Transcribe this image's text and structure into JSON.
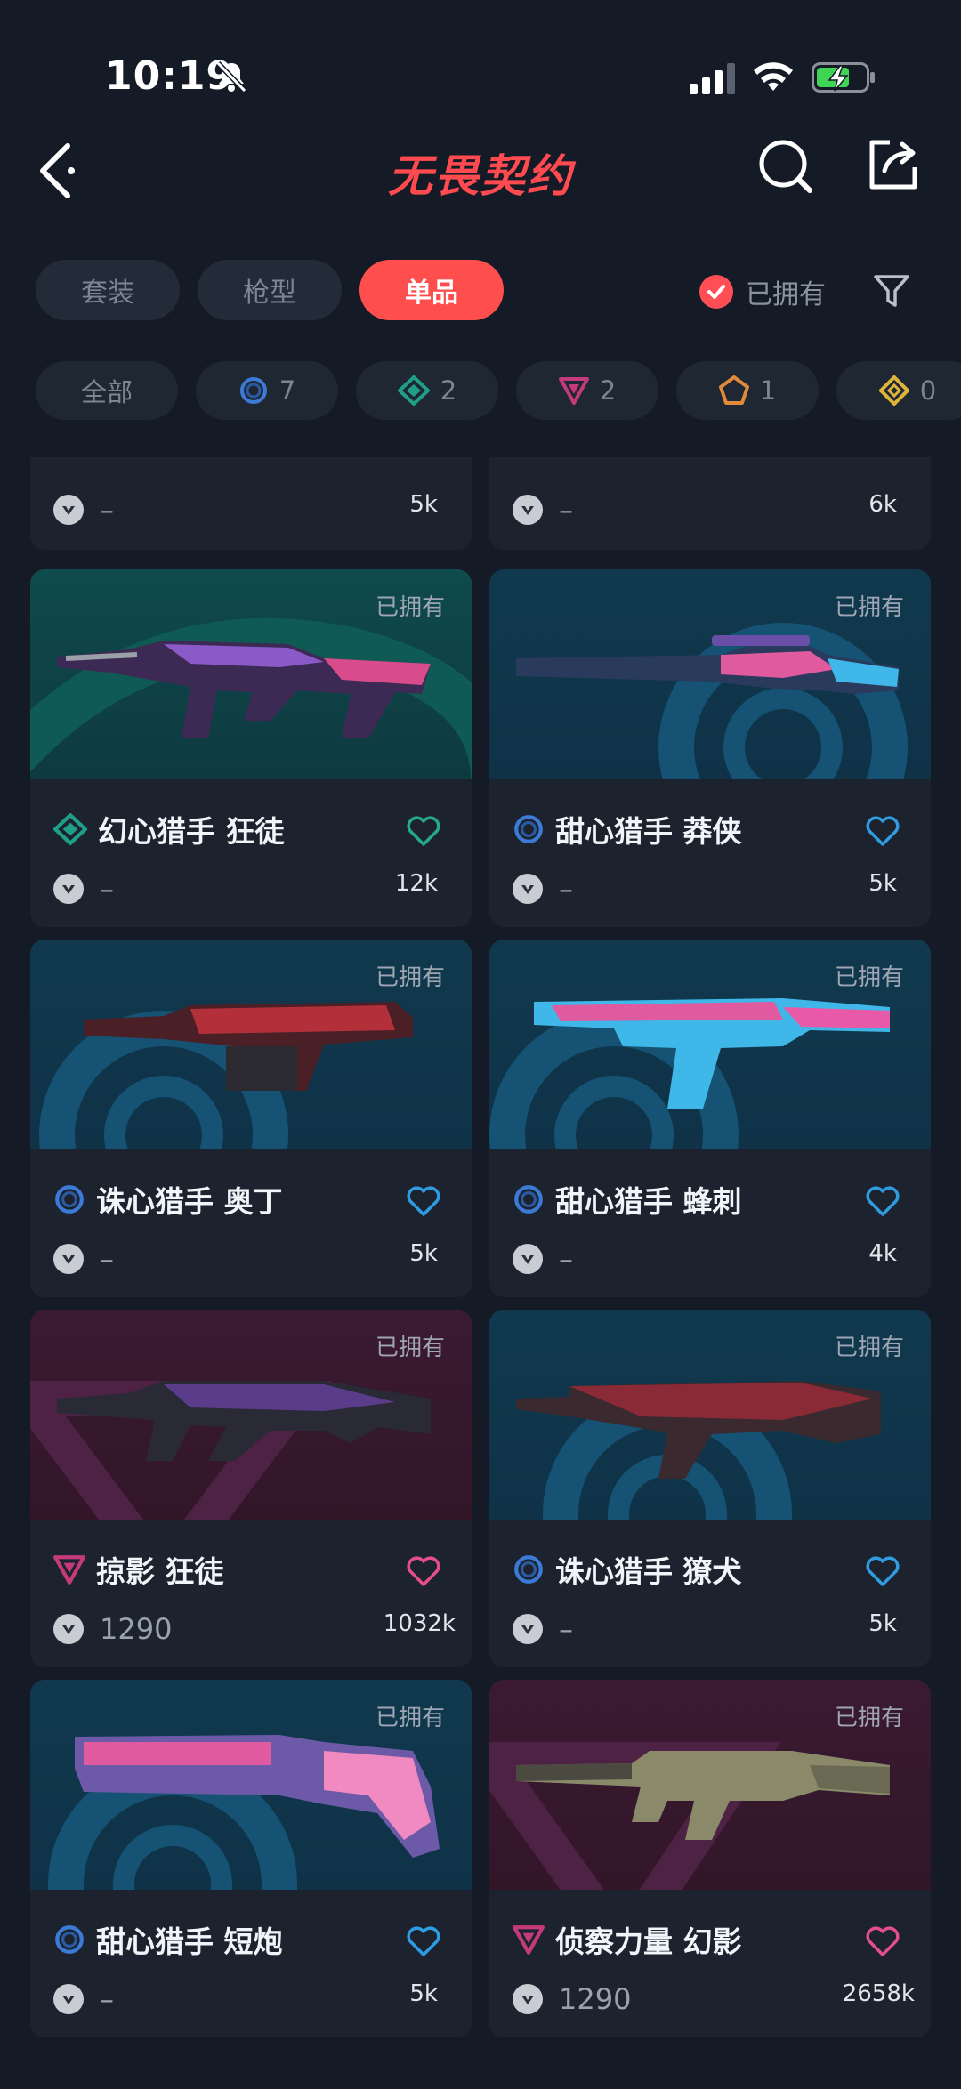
{
  "status": {
    "time": "10:19"
  },
  "nav": {
    "title": "无畏契约"
  },
  "tabs": [
    {
      "label": "套装",
      "active": false
    },
    {
      "label": "枪型",
      "active": false
    },
    {
      "label": "单品",
      "active": true
    }
  ],
  "owned_filter": {
    "label": "已拥有",
    "checked": true
  },
  "chips": [
    {
      "label": "全部",
      "icon": ""
    },
    {
      "label": "7",
      "icon": "select-tier-icon",
      "color": "#3b7bd6"
    },
    {
      "label": "2",
      "icon": "deluxe-tier-icon",
      "color": "#1f9e88"
    },
    {
      "label": "2",
      "icon": "premium-tier-icon",
      "color": "#c43a7a"
    },
    {
      "label": "1",
      "icon": "exclusive-tier-icon",
      "color": "#e08a3a"
    },
    {
      "label": "0",
      "icon": "ultra-tier-icon",
      "color": "#e0b43a"
    }
  ],
  "partial_cards": [
    {
      "price": "–",
      "count": "5k"
    },
    {
      "price": "–",
      "count": "6k"
    }
  ],
  "cards": [
    {
      "owned": "已拥有",
      "name": "幻心猎手 狂徒",
      "price": "–",
      "count": "12k",
      "bg": "teal",
      "tier": "deluxe",
      "heart_color": "#27a889"
    },
    {
      "owned": "已拥有",
      "name": "甜心猎手 莽侠",
      "price": "–",
      "count": "5k",
      "bg": "blue",
      "tier": "select",
      "heart_color": "#2f9be0"
    },
    {
      "owned": "已拥有",
      "name": "诛心猎手 奥丁",
      "price": "–",
      "count": "5k",
      "bg": "blue",
      "tier": "select",
      "heart_color": "#2f9be0"
    },
    {
      "owned": "已拥有",
      "name": "甜心猎手 蜂刺",
      "price": "–",
      "count": "4k",
      "bg": "blue",
      "tier": "select",
      "heart_color": "#2f9be0"
    },
    {
      "owned": "已拥有",
      "name": "掠影 狂徒",
      "price": "1290",
      "count": "1032k",
      "bg": "maroon",
      "tier": "premium",
      "heart_color": "#e34e8b"
    },
    {
      "owned": "已拥有",
      "name": "诛心猎手 獠犬",
      "price": "–",
      "count": "5k",
      "bg": "blue",
      "tier": "select",
      "heart_color": "#2f9be0"
    },
    {
      "owned": "已拥有",
      "name": "甜心猎手 短炮",
      "price": "–",
      "count": "5k",
      "bg": "blue",
      "tier": "select",
      "heart_color": "#2f9be0"
    },
    {
      "owned": "已拥有",
      "name": "侦察力量 幻影",
      "price": "1290",
      "count": "2658k",
      "bg": "maroon",
      "tier": "premium",
      "heart_color": "#e34e8b"
    }
  ]
}
